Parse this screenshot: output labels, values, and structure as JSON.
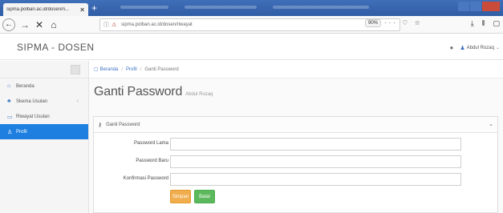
{
  "browser": {
    "tab_title": "sipma.polban.ac.id/dosen/ri...",
    "tab_close": "✕",
    "new_tab": "+",
    "url": "sipma.polban.ac.id/dosen/riwayat",
    "zoom": "90%",
    "url_actions": "··· ♡ ☆",
    "nav": {
      "back": "←",
      "forward": "→",
      "stop": "✕",
      "home": "⌂"
    },
    "toolbar_icons": {
      "download": "⤓",
      "library": "⫴",
      "sidebar": "▢"
    }
  },
  "app": {
    "title": "SIPMA - DOSEN",
    "user_name": "Abdul Rozaq"
  },
  "sidebar": {
    "items": [
      {
        "label": "Beranda",
        "icon": "home-icon",
        "glyph": "⌂",
        "active": false
      },
      {
        "label": "Skema Usulan",
        "icon": "sitemap-icon",
        "glyph": "♣",
        "arrow": "‹",
        "active": false
      },
      {
        "label": "Riwayat Usulan",
        "icon": "folder-icon",
        "glyph": "▭",
        "active": false
      },
      {
        "label": "Profil",
        "icon": "user-icon",
        "glyph": "♙",
        "active": true
      }
    ]
  },
  "breadcrumb": {
    "home": "Beranda",
    "profile": "Profil",
    "current": "Ganti Password",
    "sep": "/"
  },
  "page": {
    "title": "Ganti Password",
    "subtitle": "Abdul Rozaq"
  },
  "panel": {
    "title": "Ganti Password",
    "fields": {
      "old_password_label": "Password Lama",
      "new_password_label": "Password Baru",
      "confirm_password_label": "Konfirmasi Password",
      "old_password_value": "",
      "new_password_value": "",
      "confirm_password_value": ""
    },
    "buttons": {
      "save": "Simpan",
      "cancel": "Batal"
    }
  },
  "colors": {
    "active_menu": "#1e7fe0",
    "save_button": "#f0ad4e",
    "cancel_button": "#5cb85c",
    "browser_tabbar": "#2f5da6"
  }
}
